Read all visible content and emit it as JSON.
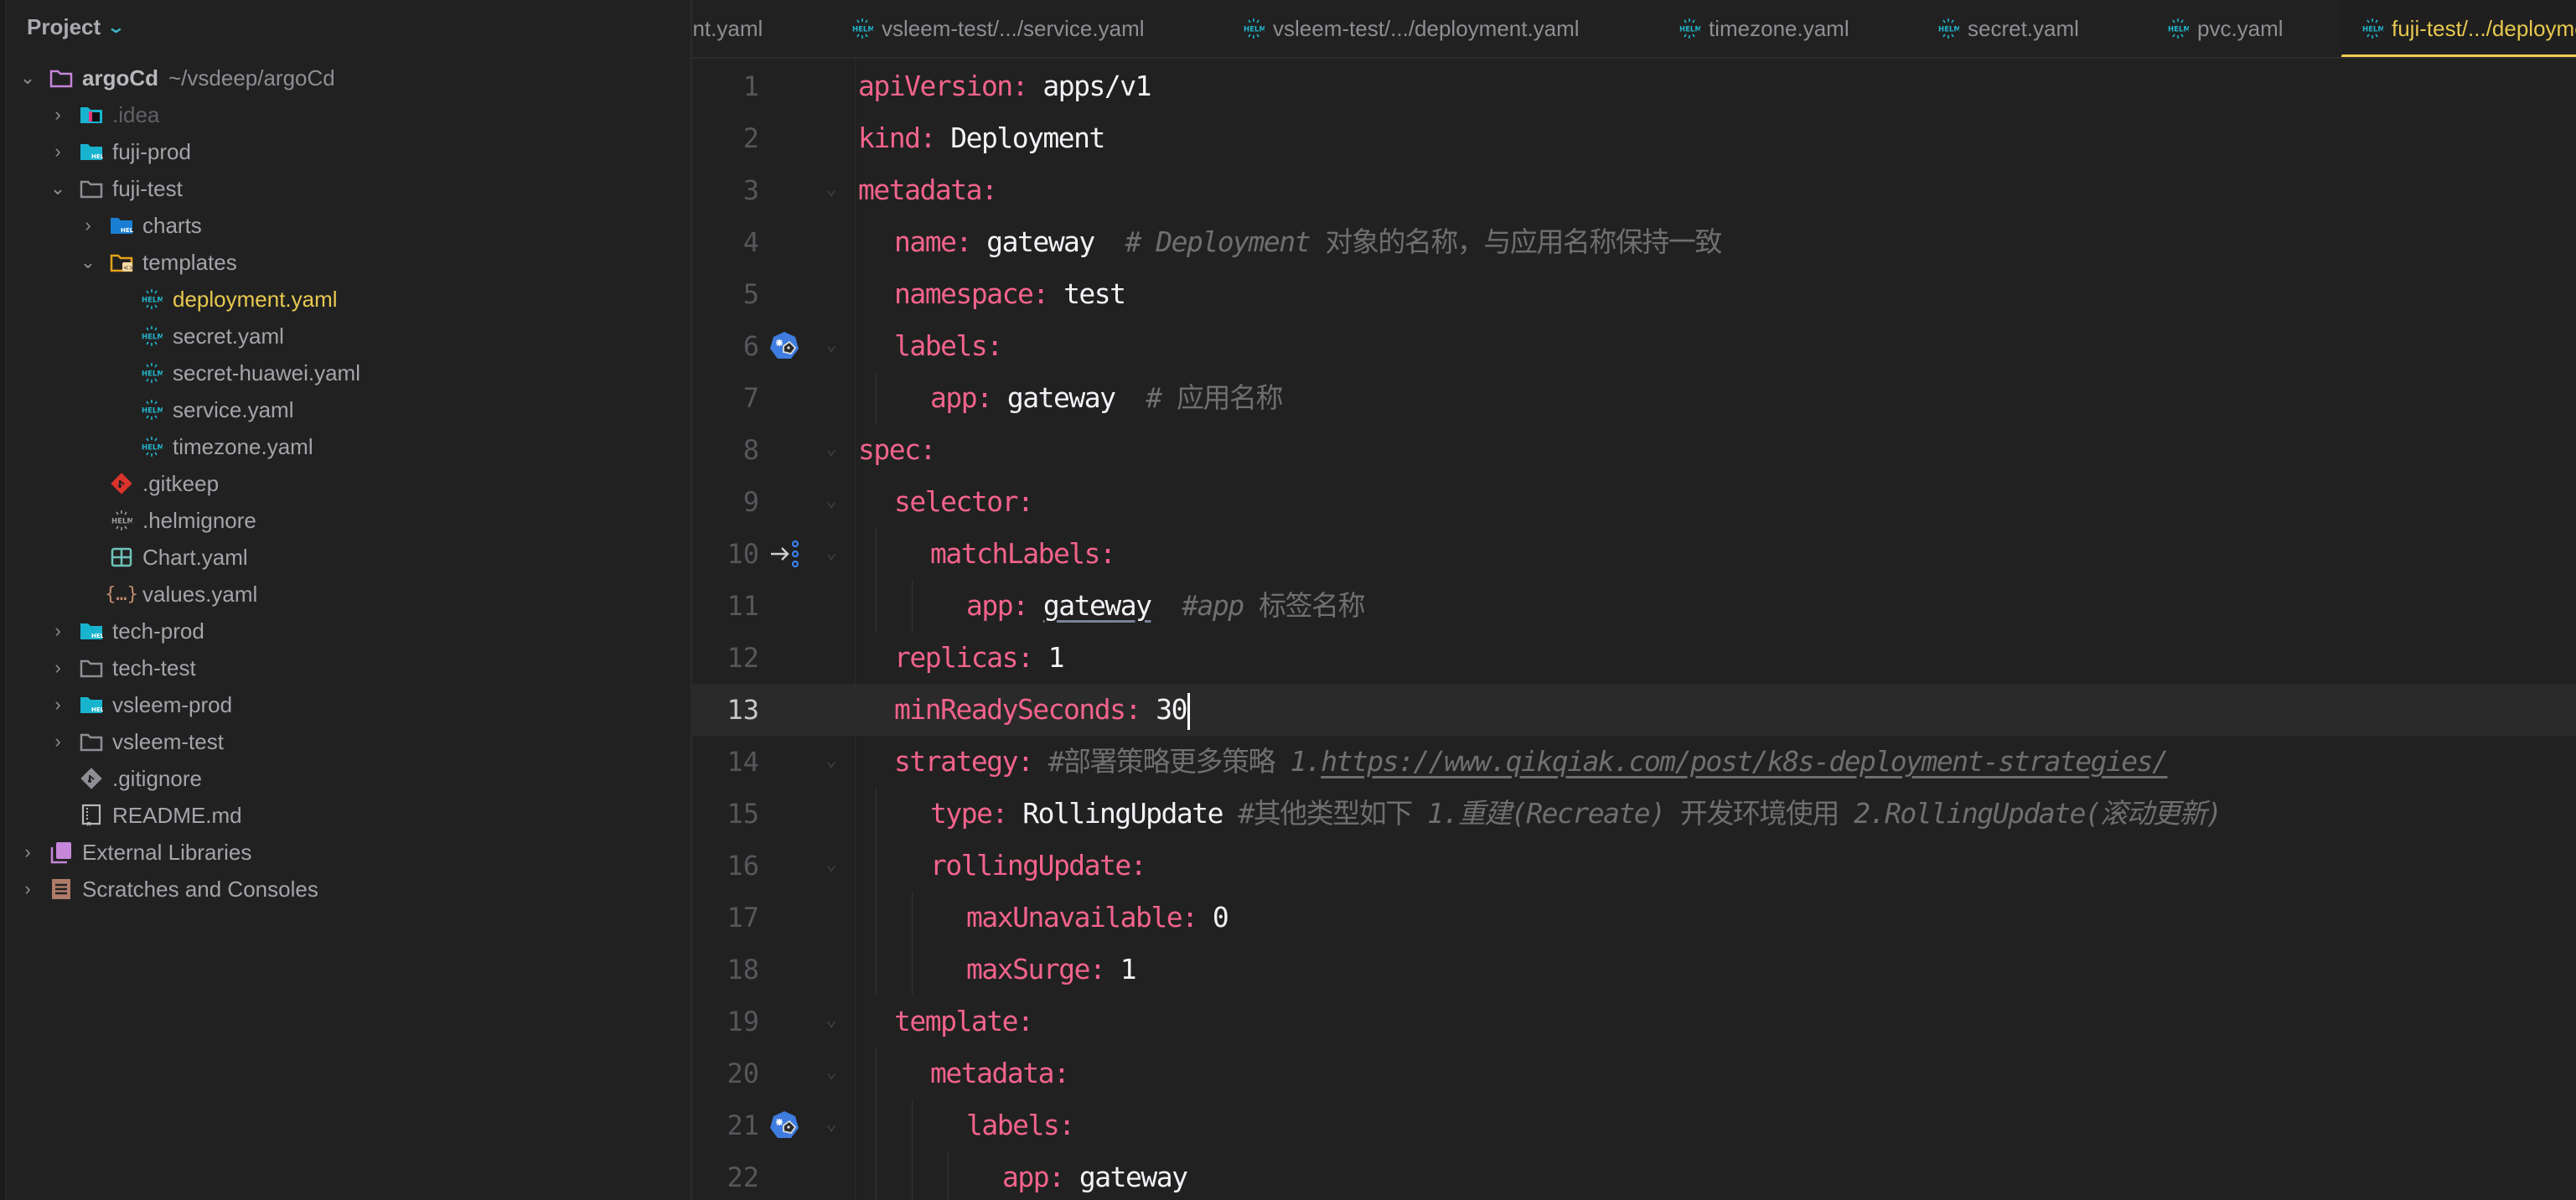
{
  "sidebar": {
    "header": "Project",
    "root": {
      "name": "argoCd",
      "path": "~/vsdeep/argoCd"
    },
    "items": [
      {
        "label": ".idea",
        "icon": "idea-folder-icon"
      },
      {
        "label": "fuji-prod",
        "icon": "helm-folder-icon"
      },
      {
        "label": "fuji-test",
        "icon": "folder-icon"
      },
      {
        "label": "charts",
        "icon": "helm-folder-icon"
      },
      {
        "label": "templates",
        "icon": "templates-folder-icon"
      },
      {
        "label": "deployment.yaml",
        "icon": "helm-file-icon",
        "selected": true
      },
      {
        "label": "secret.yaml",
        "icon": "helm-file-icon"
      },
      {
        "label": "secret-huawei.yaml",
        "icon": "helm-file-icon"
      },
      {
        "label": "service.yaml",
        "icon": "helm-file-icon"
      },
      {
        "label": "timezone.yaml",
        "icon": "helm-file-icon"
      },
      {
        "label": ".gitkeep",
        "icon": "git-icon"
      },
      {
        "label": ".helmignore",
        "icon": "helm-ignore-icon"
      },
      {
        "label": "Chart.yaml",
        "icon": "chart-table-icon"
      },
      {
        "label": "values.yaml",
        "icon": "braces-icon"
      },
      {
        "label": "tech-prod",
        "icon": "helm-folder-icon"
      },
      {
        "label": "tech-test",
        "icon": "folder-icon"
      },
      {
        "label": "vsleem-prod",
        "icon": "helm-folder-icon"
      },
      {
        "label": "vsleem-test",
        "icon": "folder-icon"
      },
      {
        "label": ".gitignore",
        "icon": "gitignore-icon"
      },
      {
        "label": "README.md",
        "icon": "readme-icon"
      },
      {
        "label": "External Libraries",
        "icon": "library-icon"
      },
      {
        "label": "Scratches and Consoles",
        "icon": "scratches-icon"
      }
    ]
  },
  "tabs": [
    {
      "label": "ent.yaml",
      "icon": null
    },
    {
      "label": "vsleem-test/.../service.yaml",
      "icon": "helm-icon"
    },
    {
      "label": "vsleem-test/.../deployment.yaml",
      "icon": "helm-icon"
    },
    {
      "label": "timezone.yaml",
      "icon": "helm-icon"
    },
    {
      "label": "secret.yaml",
      "icon": "helm-icon"
    },
    {
      "label": "pvc.yaml",
      "icon": "helm-icon"
    },
    {
      "label": "fuji-test/.../deployment.yaml",
      "icon": "helm-icon",
      "active": true
    }
  ],
  "editor": {
    "current_line": 13,
    "lines": [
      {
        "n": "1",
        "key": "apiVersion:",
        "val": "apps/v1"
      },
      {
        "n": "2",
        "key": "kind:",
        "val": "Deployment"
      },
      {
        "n": "3",
        "key": "metadata:"
      },
      {
        "n": "4",
        "key": "name:",
        "val": "gateway",
        "comment_a": "# Deployment",
        "comment_b": "对象的名称，与应用名称保持一致"
      },
      {
        "n": "5",
        "key": "namespace:",
        "val": "test"
      },
      {
        "n": "6",
        "key": "labels:"
      },
      {
        "n": "7",
        "key": "app:",
        "val": "gateway",
        "comment_a": "#",
        "comment_b": "应用名称"
      },
      {
        "n": "8",
        "key": "spec:"
      },
      {
        "n": "9",
        "key": "selector:"
      },
      {
        "n": "10",
        "key": "matchLabels:"
      },
      {
        "n": "11",
        "key": "app:",
        "val": "gateway",
        "comment_a": "#app",
        "comment_b": "标签名称"
      },
      {
        "n": "12",
        "key": "replicas:",
        "val": "1"
      },
      {
        "n": "13",
        "key": "minReadySeconds:",
        "val": "30"
      },
      {
        "n": "14",
        "key": "strategy:",
        "comment_b": "#部署策略更多策略",
        "comment_a": "1.",
        "url": "https://www.qikqiak.com/post/k8s-deployment-strategies/"
      },
      {
        "n": "15",
        "key": "type:",
        "val": "RollingUpdate",
        "comment_b": "#其他类型如下",
        "comment_a": "1.重建(Recreate)",
        "comment_c": "开发环境使用",
        "comment_d": "2.RollingUpdate(滚动更新)"
      },
      {
        "n": "16",
        "key": "rollingUpdate:"
      },
      {
        "n": "17",
        "key": "maxUnavailable:",
        "val": "0"
      },
      {
        "n": "18",
        "key": "maxSurge:",
        "val": "1"
      },
      {
        "n": "19",
        "key": "template:"
      },
      {
        "n": "20",
        "key": "metadata:"
      },
      {
        "n": "21",
        "key": "labels:"
      },
      {
        "n": "22",
        "key": "app:",
        "val": "gateway"
      }
    ]
  },
  "colors": {
    "key": "#f2638c",
    "value": "#f4f2f7",
    "comment": "#6f6f72",
    "selected_file": "#e8c84f",
    "active_tab_underline": "#f2cc55"
  }
}
